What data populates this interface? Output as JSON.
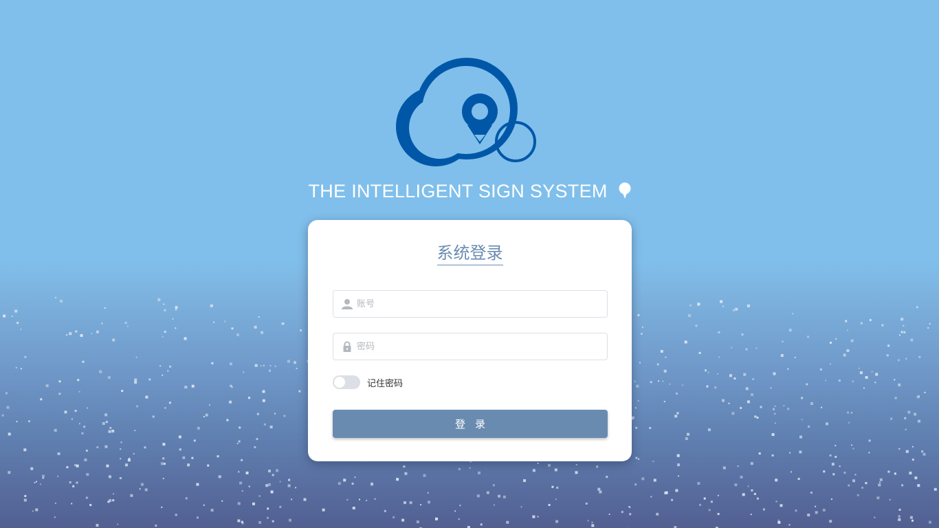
{
  "background": {
    "sky_color": "#80bfeb",
    "bottom_color": "#525f91"
  },
  "brand": {
    "logo_icon": "cloud-location-pin-logo",
    "logo_color": "#0057a8",
    "title": "THE INTELLIGENT SIGN SYSTEM",
    "title_icon": "balloon-pin-icon"
  },
  "login": {
    "title": "系统登录",
    "username_placeholder": "账号",
    "username_icon": "user-icon",
    "password_placeholder": "密码",
    "password_icon": "lock-icon",
    "remember_label": "记住密码",
    "remember_on": false,
    "submit_label": "登录",
    "accent_color": "#6a8bb0"
  }
}
